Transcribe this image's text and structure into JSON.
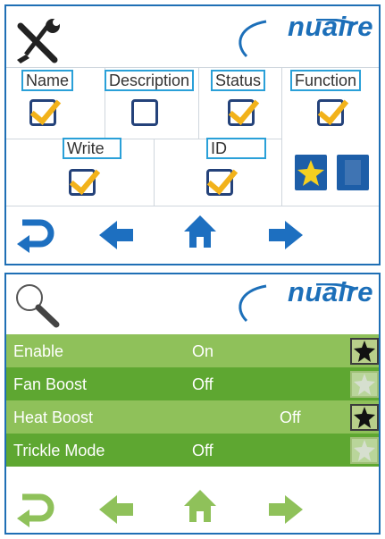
{
  "panel1": {
    "logo": "nuaire",
    "icon": "wrench-screwdriver-icon",
    "columns": [
      {
        "label": "Name",
        "checked": true
      },
      {
        "label": "Description",
        "checked": false
      },
      {
        "label": "Status",
        "checked": true
      },
      {
        "label": "Function",
        "checked": true
      }
    ],
    "row2": [
      {
        "label": "Write",
        "checked": true
      },
      {
        "label": "ID",
        "checked": true
      }
    ],
    "nav": [
      "return-icon",
      "back-arrow-icon",
      "home-icon",
      "forward-arrow-icon"
    ],
    "colors": {
      "accent": "#1c6fb9",
      "check": "#f2b21a",
      "star": "#f5d020"
    }
  },
  "panel2": {
    "logo": "nuaire",
    "icon": "magnifier-icon",
    "rows": [
      {
        "name": "Enable",
        "value": "On",
        "star_active": true
      },
      {
        "name": "Fan Boost",
        "value": "Off",
        "star_active": false
      },
      {
        "name": "Heat Boost",
        "value": "Off",
        "star_active": true
      },
      {
        "name": "Trickle Mode",
        "value": "Off",
        "star_active": false
      }
    ],
    "colors": {
      "row_light": "#8fc15a",
      "row_dark": "#5ea731",
      "nav": "#8fc15a"
    }
  }
}
